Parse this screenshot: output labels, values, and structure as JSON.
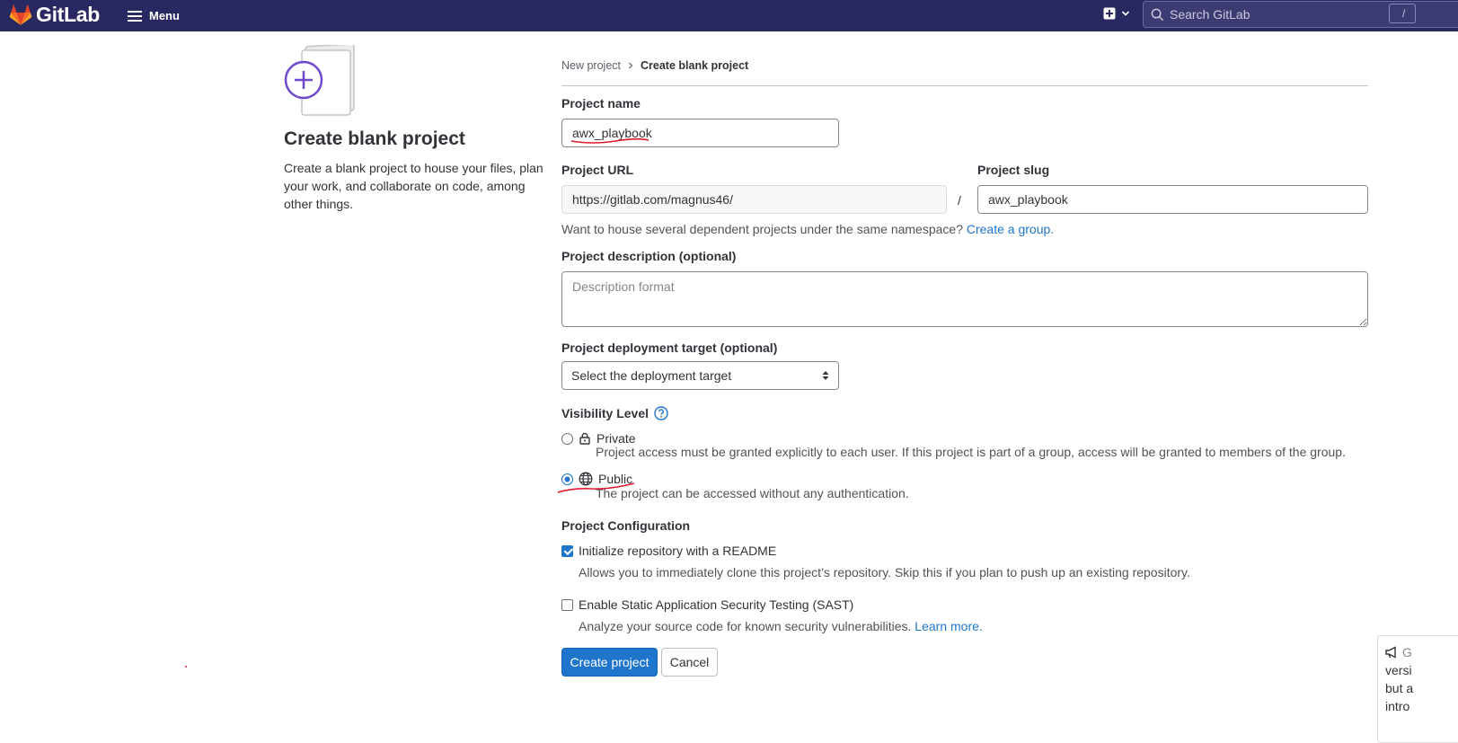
{
  "navbar": {
    "logo_text": "GitLab",
    "menu_label": "Menu",
    "search_placeholder": "Search GitLab",
    "search_shortcut": "/",
    "bg_color": "#292961"
  },
  "intro": {
    "title": "Create blank project",
    "description": "Create a blank project to house your files, plan your work, and collaborate on code, among other things."
  },
  "breadcrumb": {
    "parent": "New project",
    "current": "Create blank project"
  },
  "form": {
    "project_name": {
      "label": "Project name",
      "value": "awx_playbook"
    },
    "project_url": {
      "label": "Project URL",
      "value": "https://gitlab.com/magnus46/",
      "separator": "/"
    },
    "project_slug": {
      "label": "Project slug",
      "value": "awx_playbook"
    },
    "namespace_help": {
      "text": "Want to house several dependent projects under the same namespace?",
      "link": "Create a group."
    },
    "description": {
      "label": "Project description (optional)",
      "placeholder": "Description format"
    },
    "deployment": {
      "label": "Project deployment target (optional)",
      "selected": "Select the deployment target"
    },
    "visibility": {
      "label": "Visibility Level",
      "options": [
        {
          "label": "Private",
          "icon": "lock-icon",
          "description": "Project access must be granted explicitly to each user. If this project is part of a group, access will be granted to members of the group.",
          "selected": false
        },
        {
          "label": "Public",
          "icon": "globe-icon",
          "description": "The project can be accessed without any authentication.",
          "selected": true
        }
      ]
    },
    "configuration": {
      "label": "Project Configuration",
      "options": [
        {
          "label": "Initialize repository with a README",
          "description": "Allows you to immediately clone this project’s repository. Skip this if you plan to push up an existing repository.",
          "checked": true
        },
        {
          "label": "Enable Static Application Security Testing (SAST)",
          "description": "Analyze your source code for known security vulnerabilities.",
          "link": "Learn more.",
          "checked": false
        }
      ]
    },
    "create_button": "Create project",
    "cancel_button": "Cancel"
  },
  "broadcast": {
    "icon": "megaphone-icon",
    "lines": [
      "G",
      "versi",
      "but a",
      "intro"
    ]
  },
  "colors": {
    "primary": "#1f75cb",
    "annotation": "#e0192b"
  }
}
